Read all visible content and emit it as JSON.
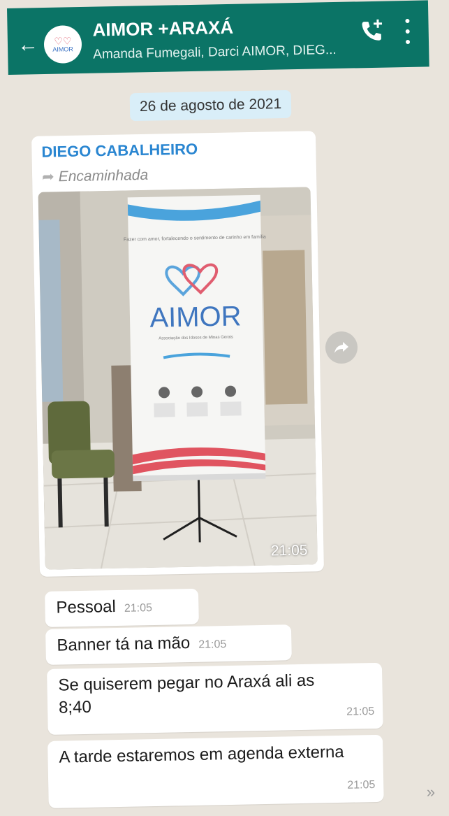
{
  "header": {
    "back_icon": "arrow-left-icon",
    "avatar_label": "AIMOR",
    "title": "AIMOR +ARAXÁ",
    "subtitle": "Amanda Fumegali, Darci AIMOR, DIEG...",
    "call_icon": "add-call-icon",
    "menu_icon": "more-vert-icon",
    "bar_color": "#0b7466"
  },
  "date_pill": "26 de agosto de 2021",
  "media_message": {
    "sender": "DIEGO CABALHEIRO",
    "forwarded_label": "Encaminhada",
    "time": "21:05",
    "banner": {
      "tagline": "Fazer com amor, fortalecendo o sentimento de carinho em família",
      "logo": "AIMOR",
      "org": "Associação dos Idosos de Minas Gerais"
    }
  },
  "messages": [
    {
      "text": "Pessoal",
      "time": "21:05"
    },
    {
      "text": "Banner tá na mão",
      "time": "21:05"
    },
    {
      "text": "Se quiserem pegar no Araxá ali as 8;40",
      "time": "21:05"
    },
    {
      "text": "A tarde estaremos em agenda externa",
      "time": "21:05"
    }
  ],
  "colors": {
    "accent_blue": "#2a86d1",
    "chat_bg": "#e9e4dc"
  }
}
